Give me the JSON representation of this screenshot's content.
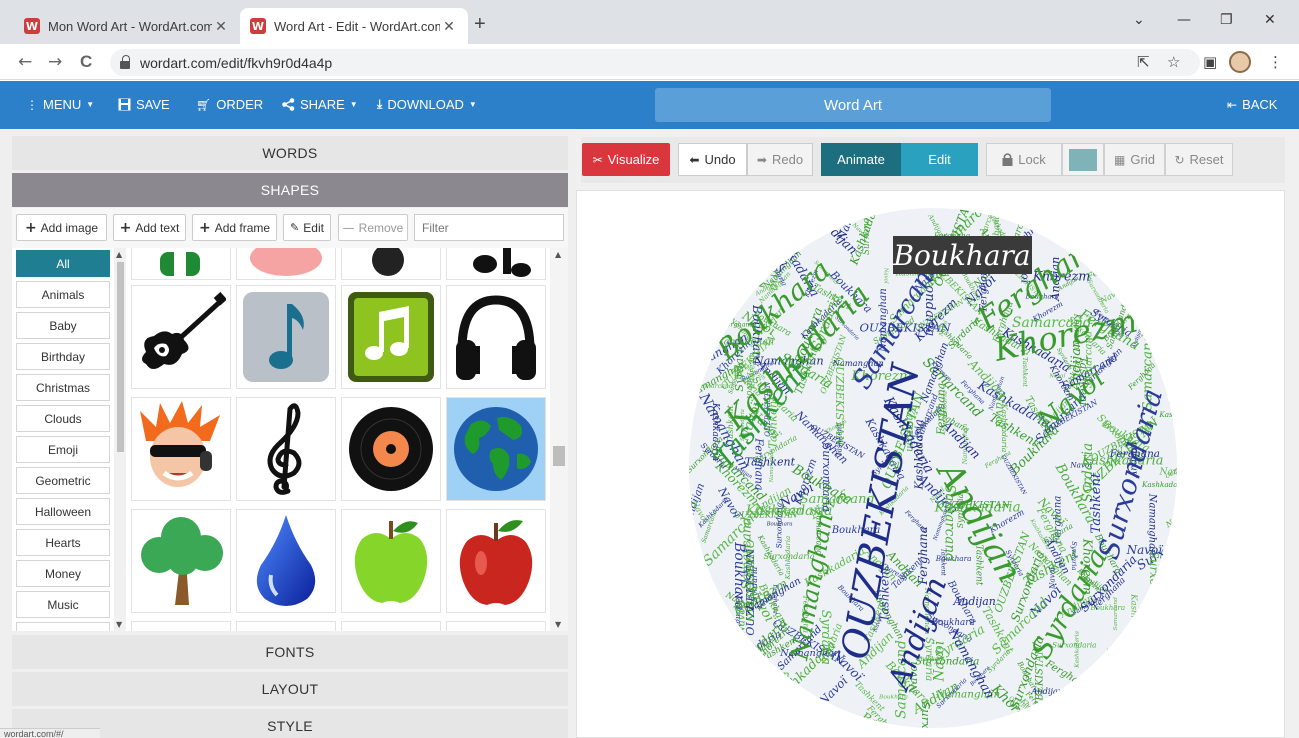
{
  "browser": {
    "tabs": [
      {
        "title": "Mon Word Art - WordArt.com",
        "favicon": "W"
      },
      {
        "title": "Word Art - Edit - WordArt.com",
        "favicon": "W"
      }
    ],
    "new_tab": "+",
    "window_controls": {
      "dropdown": "⌄",
      "minimize": "—",
      "restore": "❐",
      "close": "✕"
    },
    "url": "wordart.com/edit/fkvh9r0d4a4p",
    "nav": {
      "back": "←",
      "forward": "→",
      "reload": "C"
    },
    "icons": {
      "share": "⇱",
      "star": "☆",
      "sidebar": "▣",
      "menu": "⋮"
    }
  },
  "appnav": {
    "menu": "MENU",
    "save": "SAVE",
    "order": "ORDER",
    "share": "SHARE",
    "download": "DOWNLOAD",
    "title": "Word Art",
    "back": "BACK"
  },
  "left": {
    "sections": {
      "words": "WORDS",
      "shapes": "SHAPES",
      "fonts": "FONTS",
      "layout": "LAYOUT",
      "style": "STYLE"
    },
    "toolbar": {
      "add_image": "Add image",
      "add_text": "Add text",
      "add_frame": "Add frame",
      "edit": "Edit",
      "remove": "Remove",
      "filter_placeholder": "Filter"
    },
    "categories": [
      "All",
      "Animals",
      "Baby",
      "Birthday",
      "Christmas",
      "Clouds",
      "Emoji",
      "Geometric",
      "Halloween",
      "Hearts",
      "Money",
      "Music"
    ],
    "shapes": [
      "Electric guitar",
      "Music note",
      "Music app",
      "Headphones",
      "Rocker face",
      "Treble clef",
      "Vinyl record",
      "Earth globe",
      "Tree",
      "Water drop",
      "Green apple",
      "Red apple"
    ]
  },
  "right": {
    "visualize": "Visualize",
    "undo": "Undo",
    "redo": "Redo",
    "animate": "Animate",
    "edit": "Edit",
    "lock": "Lock",
    "grid": "Grid",
    "reset": "Reset",
    "color_swatch": "#7fb3b8",
    "highlight_word": "Boukhara"
  },
  "wordcloud": {
    "words": [
      "Boukhara",
      "Kashkadaria",
      "Tashkent",
      "Samarcand",
      "Ferghana",
      "Khorezm",
      "Navoï",
      "OUZBEKISTAN",
      "Andijan",
      "Surxondaria",
      "Syrdaria",
      "Namanghan"
    ]
  },
  "status_bar": "wordart.com/#/"
}
